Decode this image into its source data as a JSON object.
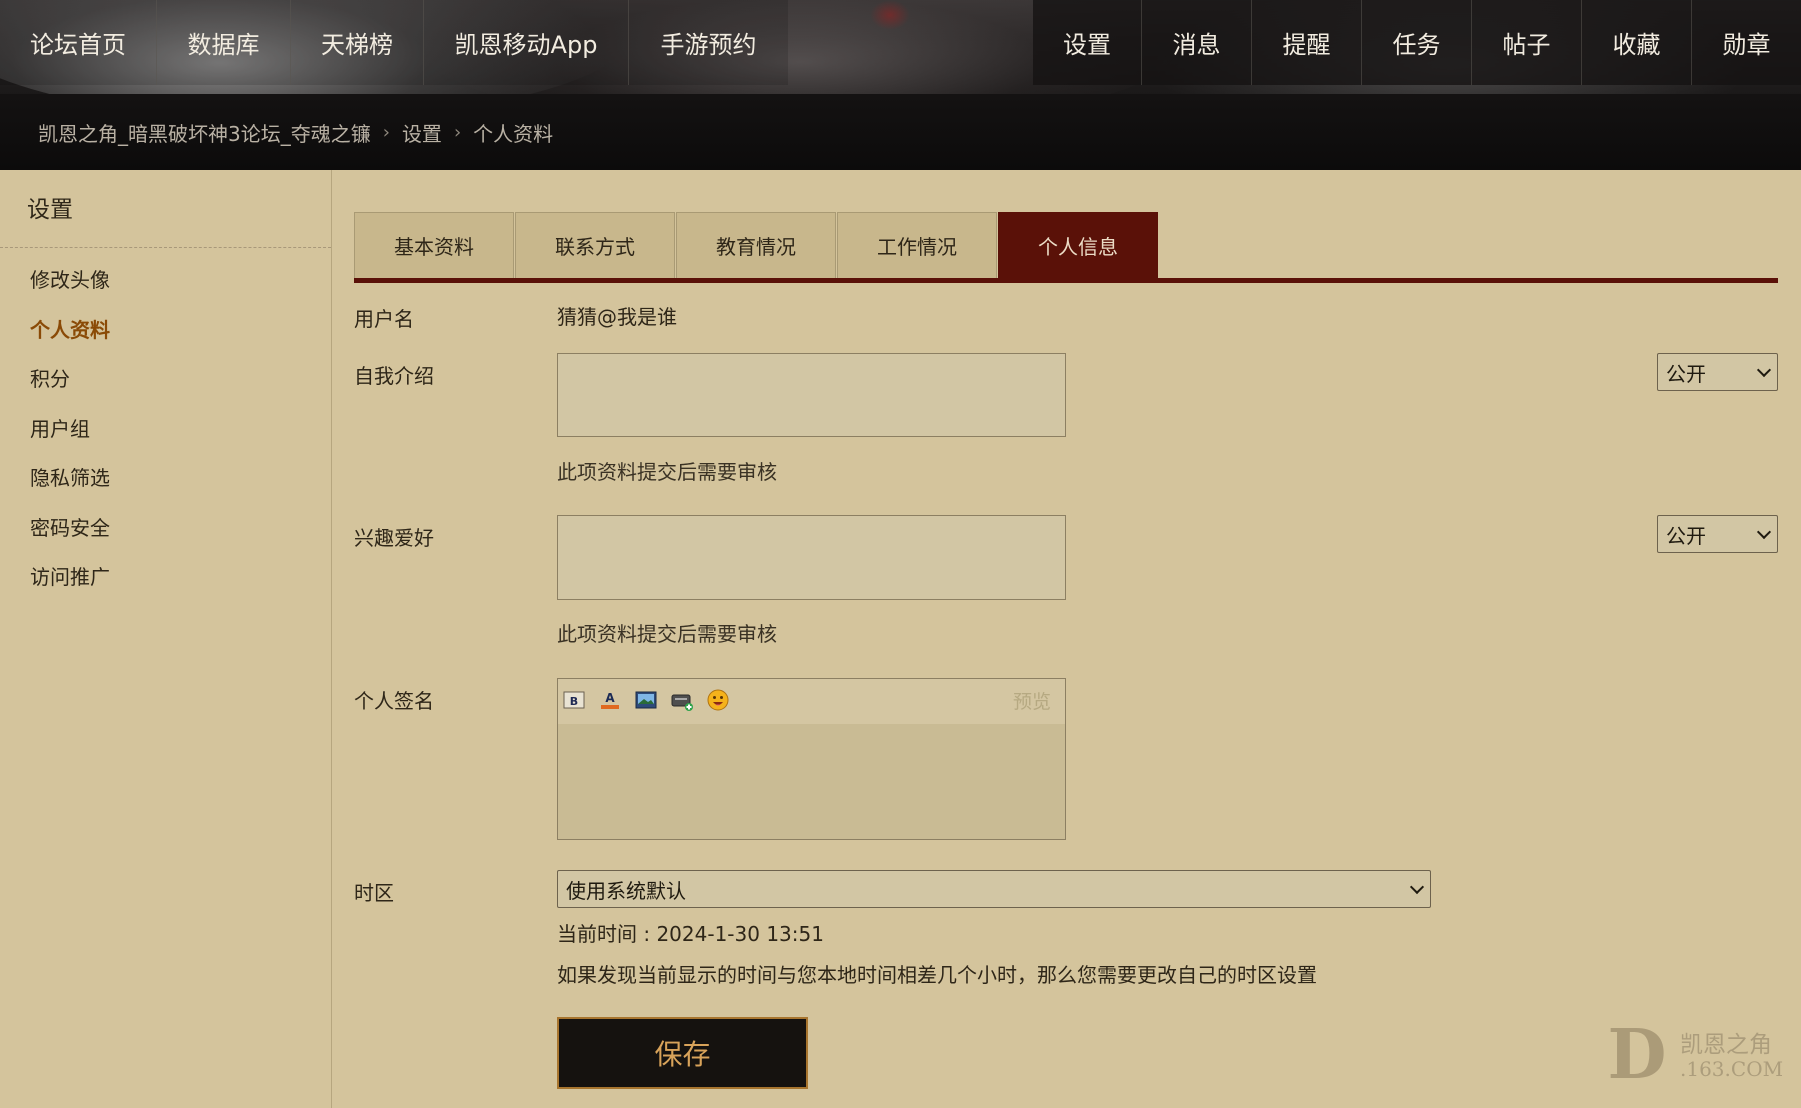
{
  "nav": {
    "left": [
      "论坛首页",
      "数据库",
      "天梯榜",
      "凯恩移动App",
      "手游预约"
    ],
    "right": [
      "设置",
      "消息",
      "提醒",
      "任务",
      "帖子",
      "收藏",
      "勋章"
    ]
  },
  "breadcrumb": {
    "site": "凯恩之角_暗黑破坏神3论坛_夺魂之镰",
    "sep": "›",
    "settings": "设置",
    "current": "个人资料"
  },
  "sidebar": {
    "title": "设置",
    "items": [
      "修改头像",
      "个人资料",
      "积分",
      "用户组",
      "隐私筛选",
      "密码安全",
      "访问推广"
    ],
    "active_index": 1
  },
  "tabs": {
    "items": [
      "基本资料",
      "联系方式",
      "教育情况",
      "工作情况",
      "个人信息"
    ],
    "active_index": 4
  },
  "form": {
    "username_label": "用户名",
    "username_value": "猜猜@我是谁",
    "intro_label": "自我介绍",
    "intro_privacy": "公开",
    "intro_note": "此项资料提交后需要审核",
    "hobby_label": "兴趣爱好",
    "hobby_privacy": "公开",
    "hobby_note": "此项资料提交后需要审核",
    "signature_label": "个人签名",
    "signature_preview": "预览",
    "timezone_label": "时区",
    "timezone_value": "使用系统默认",
    "current_time": "当前时间 : 2024-1-30 13:51",
    "timezone_hint": "如果发现当前显示的时间与您本地时间相差几个小时，那么您需要更改自己的时区设置",
    "save_label": "保存"
  },
  "watermark": {
    "letter": "D",
    "line1": "凯恩之角",
    "line2": ".163.COM"
  },
  "colors": {
    "background": "#d4c49c",
    "tab_active": "#5a1108",
    "sidebar_active": "#8a4a06",
    "button_bg": "#15120f",
    "button_text": "#d8a35a"
  },
  "icons": [
    "bold-icon",
    "font-color-icon",
    "image-icon",
    "link-icon",
    "emoticon-icon"
  ]
}
